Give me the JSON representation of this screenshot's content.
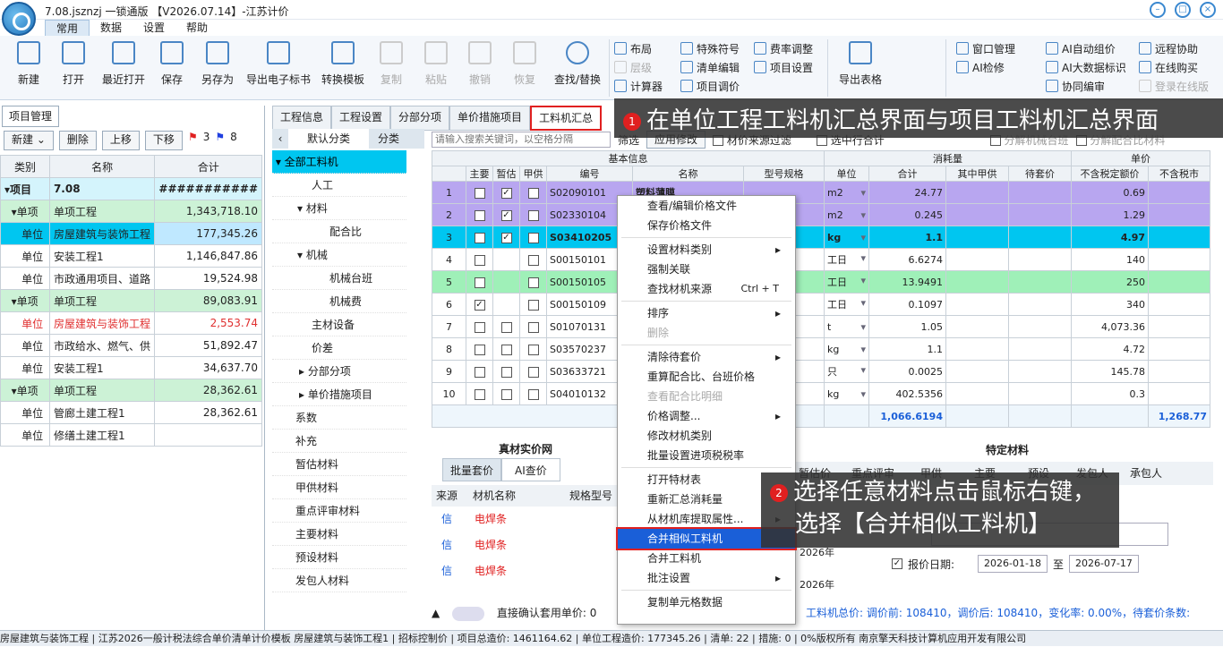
{
  "window": {
    "title": "7.08.jsznzj  一锁通版 【V2026.07.14】-江苏计价"
  },
  "menu_tabs": [
    "常用",
    "数据",
    "设置",
    "帮助"
  ],
  "ribbon": {
    "big": [
      "新建",
      "打开",
      "最近打开",
      "保存",
      "另存为",
      "导出电子标书",
      "转换模板",
      "复制",
      "粘贴",
      "撤销",
      "恢复",
      "查找/替换"
    ],
    "small1": [
      "布局",
      "层级",
      "计算器"
    ],
    "small2": [
      "特殊符号",
      "清单编辑",
      "项目调价"
    ],
    "small3": [
      "费率调整",
      "项目设置"
    ],
    "export": "导出表格",
    "small4": [
      "窗口管理",
      "AI检修"
    ],
    "small5": [
      "AI自动组价",
      "AI大数据标识",
      "协同编审"
    ],
    "small6": [
      "远程协助",
      "在线购买",
      "登录在线版"
    ]
  },
  "left": {
    "tab": "项目管理",
    "buttons": [
      "新建",
      "删除",
      "上移",
      "下移"
    ],
    "flags": [
      "3",
      "8"
    ],
    "headers": [
      "类别",
      "名称",
      "合计"
    ],
    "rows": [
      {
        "cat": "项目",
        "name": "7.08",
        "total": "###########"
      },
      {
        "cat": "单项",
        "name": "单项工程",
        "total": "1,343,718.10"
      },
      {
        "cat": "单位",
        "name": "房屋建筑与装饰工程",
        "total": "177,345.26"
      },
      {
        "cat": "单位",
        "name": "安装工程1",
        "total": "1,146,847.86"
      },
      {
        "cat": "单位",
        "name": "市政通用项目、道路",
        "total": "19,524.98"
      },
      {
        "cat": "单项",
        "name": "单项工程",
        "total": "89,083.91"
      },
      {
        "cat": "单位",
        "name": "房屋建筑与装饰工程",
        "total": "2,553.74"
      },
      {
        "cat": "单位",
        "name": "市政给水、燃气、供",
        "total": "51,892.47"
      },
      {
        "cat": "单位",
        "name": "安装工程1",
        "total": "34,637.70"
      },
      {
        "cat": "单项",
        "name": "单项工程",
        "total": "28,362.61"
      },
      {
        "cat": "单位",
        "name": "管廊土建工程1",
        "total": "28,362.61"
      },
      {
        "cat": "单位",
        "name": "修缮土建工程1",
        "total": ""
      }
    ]
  },
  "mid_tabs": [
    "工程信息",
    "工程设置",
    "分部分项",
    "单价措施项目",
    "工料机汇总"
  ],
  "sub_tabs": [
    "默认分类",
    "分类"
  ],
  "search_placeholder": "请输入搜索关键词，以空格分隔",
  "filter_labels": [
    "筛选",
    "应用修改",
    "材价来源过滤",
    "选中行合计",
    "分解机械台班",
    "分解配合比材料"
  ],
  "tree": [
    "全部工料机",
    "人工",
    "材料",
    "配合比",
    "机械",
    "机械台班",
    "机械费",
    "主材设备",
    "价差",
    "分部分项",
    "单价措施项目",
    "系数",
    "补充",
    "暂估材料",
    "甲供材料",
    "重点评审材料",
    "主要材料",
    "预设材料",
    "发包人材料",
    "承包人材料"
  ],
  "grid": {
    "group_headers": [
      "基本信息",
      "消耗量",
      "单价"
    ],
    "headers": [
      "主要",
      "暂估",
      "甲供",
      "编号",
      "名称",
      "型号规格",
      "单位",
      "合计",
      "其中甲供",
      "待套价",
      "不含税定额价",
      "不含税市"
    ],
    "rows": [
      {
        "n": "1",
        "c": [
          "☐",
          "☑",
          "☐"
        ],
        "code": "S02090101",
        "name": "塑料薄膜",
        "unit": "m2",
        "qty": "24.77",
        "price": "0.69"
      },
      {
        "n": "2",
        "c": [
          "☐",
          "☑",
          "☐"
        ],
        "code": "S02330104",
        "name": "",
        "unit": "m2",
        "qty": "0.245",
        "price": "1.29"
      },
      {
        "n": "3",
        "c": [
          "☐",
          "☑",
          "☐"
        ],
        "code": "S03410205",
        "name": "",
        "unit": "kg",
        "qty": "1.1",
        "price": "4.97"
      },
      {
        "n": "4",
        "c": [
          "☐",
          "",
          "☐"
        ],
        "code": "S00150101",
        "name": "",
        "unit": "工日",
        "qty": "6.6274",
        "price": "140"
      },
      {
        "n": "5",
        "c": [
          "☐",
          "",
          "☐"
        ],
        "code": "S00150105",
        "name": "",
        "unit": "工日",
        "qty": "13.9491",
        "price": "250"
      },
      {
        "n": "6",
        "c": [
          "☑",
          "",
          "☐"
        ],
        "code": "S00150109",
        "name": "",
        "unit": "工日",
        "qty": "0.1097",
        "price": "340"
      },
      {
        "n": "7",
        "c": [
          "☐",
          "☐",
          "☐"
        ],
        "code": "S01070131",
        "name": "",
        "unit": "t",
        "qty": "1.05",
        "price": "4,073.36"
      },
      {
        "n": "8",
        "c": [
          "☐",
          "☐",
          "☐"
        ],
        "code": "S03570237",
        "name": "",
        "unit": "kg",
        "qty": "1.1",
        "price": "4.72"
      },
      {
        "n": "9",
        "c": [
          "☐",
          "☐",
          "☐"
        ],
        "code": "S03633721",
        "name": "",
        "unit": "只",
        "qty": "0.0025",
        "price": "145.78"
      },
      {
        "n": "10",
        "c": [
          "☐",
          "☐",
          "☐"
        ],
        "code": "S04010132",
        "name": "",
        "unit": "kg",
        "qty": "402.5356",
        "price": "0.3"
      }
    ],
    "sum_qty": "1,066.6194",
    "sum_price": "1,268.77"
  },
  "context_menu": [
    {
      "label": "查看/编辑价格文件"
    },
    {
      "label": "保存价格文件"
    },
    {
      "sep": true
    },
    {
      "label": "设置材料类别",
      "sub": true
    },
    {
      "label": "强制关联"
    },
    {
      "label": "查找材机来源",
      "shortcut": "Ctrl + T"
    },
    {
      "sep": true
    },
    {
      "label": "排序",
      "sub": true
    },
    {
      "label": "删除",
      "dis": true
    },
    {
      "sep": true
    },
    {
      "label": "清除待套价",
      "sub": true
    },
    {
      "label": "重算配合比、台班价格"
    },
    {
      "label": "查看配合比明细",
      "dis": true
    },
    {
      "label": "价格调整...",
      "sub": true
    },
    {
      "label": "修改材机类别"
    },
    {
      "label": "批量设置进项税税率"
    },
    {
      "sep": true
    },
    {
      "label": "打开特材表"
    },
    {
      "label": "重新汇总消耗量"
    },
    {
      "label": "从材机库提取属性...",
      "sub": true
    },
    {
      "label": "合并相似工料机",
      "hot": true
    },
    {
      "label": "合并工料机"
    },
    {
      "label": "批注设置",
      "sub": true
    },
    {
      "sep": true
    },
    {
      "label": "复制单元格数据"
    }
  ],
  "callouts": [
    {
      "num": "1",
      "text": "在单位工程工料机汇总界面与项目工料机汇总界面"
    },
    {
      "num": "2",
      "text": "选择任意材料点击鼠标右键，",
      "text2": "选择【合并相似工料机】"
    }
  ],
  "bottom": {
    "title": "真材实价网",
    "tabs": [
      "批量套价",
      "AI查价"
    ],
    "headers": [
      "来源",
      "材机名称",
      "规格型号"
    ],
    "items": [
      "电焊条",
      "电焊条",
      "电焊条"
    ],
    "source": "信",
    "right_title": "特定材料",
    "right_headers": [
      "暂估价",
      "重点评审",
      "甲供",
      "主要",
      "预设",
      "发包人",
      "承包人"
    ],
    "date_label": "报价日期:",
    "date_from": "2026-01-18",
    "date_to": "2026-07-17",
    "date_sep": "至",
    "year_marks": [
      "2026年",
      "2026年"
    ]
  },
  "bottom_bar": {
    "left": "直接确认套用单价: 0",
    "right": "工料机总价: 调价前: 108410，调价后: 108410，变化率: 0.00%，待套价条数:"
  },
  "status": "房屋建筑与装饰工程 | 江苏2026一般计税法综合单价清单计价模板 房屋建筑与装饰工程1 | 招标控制价 | 项目总造价: 1461164.62 | 单位工程造价: 177345.26 | 清单: 22 | 措施: 0 | 0%版权所有 南京擎天科技计算机应用开发有限公司"
}
